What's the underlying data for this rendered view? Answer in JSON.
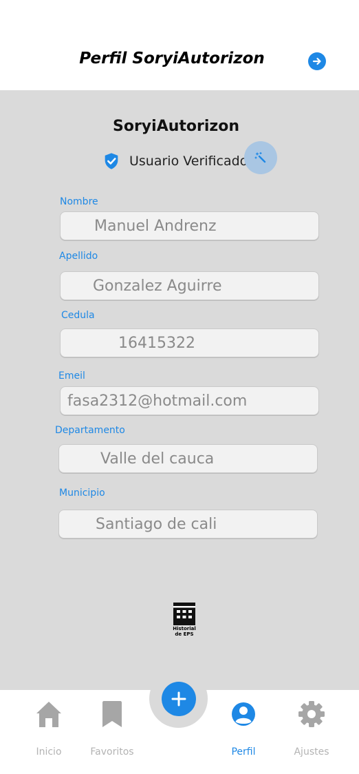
{
  "header": {
    "title": "Perfil SoryiAutorizon",
    "action_icon": "arrow-right-icon"
  },
  "profile": {
    "name": "SoryiAutorizon",
    "verified_label": "Usuario Verificado",
    "verified_icon": "shield-check-icon",
    "magic_icon": "magic-wand-icon"
  },
  "form": {
    "nombre": {
      "label": "Nombre",
      "value": "Manuel  Andrenz"
    },
    "apellido": {
      "label": "Apellido",
      "value": "Gonzalez Aguirre"
    },
    "cedula": {
      "label": "Cedula",
      "value": "16415322"
    },
    "email": {
      "label": "Emeil",
      "value": "fasa2312@hotmail.com"
    },
    "departamento": {
      "label": "Departamento",
      "value": "Valle del cauca"
    },
    "municipio": {
      "label": "Municipio",
      "value": "Santiago de cali"
    }
  },
  "eps": {
    "label": "Historial de EPS",
    "icon": "calendar-grid-icon"
  },
  "nav": {
    "items": [
      {
        "label": "Inicio",
        "icon": "home-icon"
      },
      {
        "label": "Favoritos",
        "icon": "bookmark-icon"
      },
      {
        "label": "Perfil",
        "icon": "user-circle-icon"
      },
      {
        "label": "Ajustes",
        "icon": "gear-icon"
      }
    ],
    "fab_icon": "plus-icon",
    "colors": {
      "active": "#1e88e5",
      "inactive": "#b3b3b3",
      "icon_inactive": "#a6a6a6"
    }
  }
}
